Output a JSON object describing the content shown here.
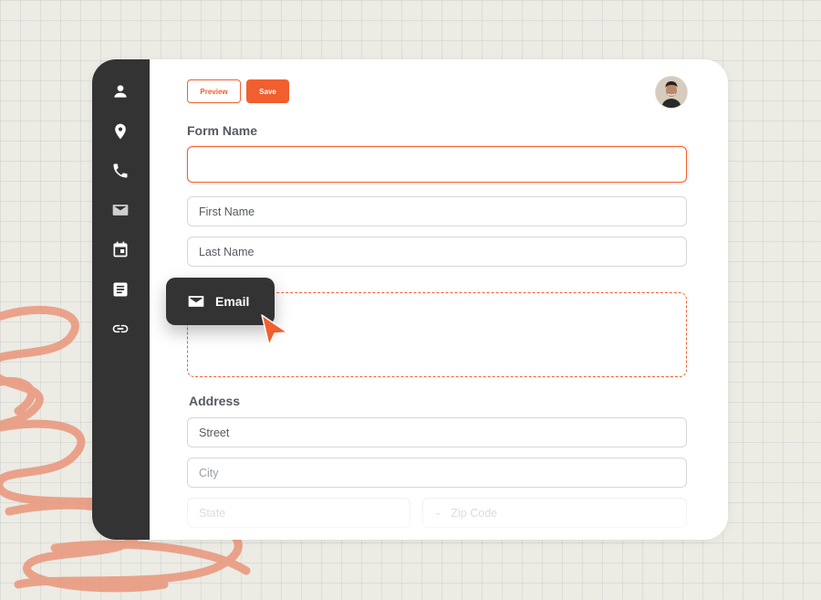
{
  "toolbar": {
    "preview_label": "Preview",
    "save_label": "Save"
  },
  "form": {
    "form_name_label": "Form Name",
    "form_name_value": "",
    "first_name_placeholder": "First Name",
    "last_name_placeholder": "Last Name"
  },
  "drag_item": {
    "label": "Email",
    "icon": "mail-icon"
  },
  "address": {
    "label": "Address",
    "street_placeholder": "Street",
    "city_placeholder": "City",
    "state_placeholder": "State",
    "zip_placeholder": "Zip Code"
  },
  "sidebar": {
    "items": [
      {
        "icon": "person-icon"
      },
      {
        "icon": "location-pin-icon"
      },
      {
        "icon": "phone-icon"
      },
      {
        "icon": "mail-icon"
      },
      {
        "icon": "calendar-icon"
      },
      {
        "icon": "document-icon"
      },
      {
        "icon": "link-icon"
      }
    ]
  },
  "colors": {
    "accent": "#f15f2e",
    "sidebar": "#333333",
    "background": "#ecebe4",
    "scribble": "#e9967a"
  }
}
